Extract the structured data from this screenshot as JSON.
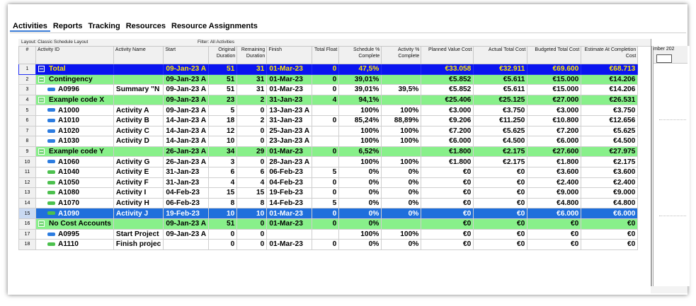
{
  "tabs": [
    "Activities",
    "Reports",
    "Tracking",
    "Resources",
    "Resource Assignments"
  ],
  "layout_label": "Layout: Classic Schedule Layout",
  "filter_label": "Filter: All Activities",
  "gantt_header": "mber 202",
  "columns": [
    {
      "key": "num",
      "label": "#"
    },
    {
      "key": "id",
      "label": "Activity ID"
    },
    {
      "key": "name",
      "label": "Activity Name"
    },
    {
      "key": "start",
      "label": "Start"
    },
    {
      "key": "od",
      "label": "Original Duration"
    },
    {
      "key": "rd",
      "label": "Remaining Duration"
    },
    {
      "key": "finish",
      "label": "Finish"
    },
    {
      "key": "tf",
      "label": "Total Float"
    },
    {
      "key": "spc",
      "label": "Schedule % Complete"
    },
    {
      "key": "apc",
      "label": "Activity % Complete"
    },
    {
      "key": "pvc",
      "label": "Planned Value Cost"
    },
    {
      "key": "atc",
      "label": "Actual Total Cost"
    },
    {
      "key": "btc",
      "label": "Budgeted Total Cost"
    },
    {
      "key": "eac",
      "label": "Estimate At Completion Cost"
    }
  ],
  "rows": [
    {
      "num": "1",
      "type": "total",
      "id": "Total",
      "name": "",
      "start": "09-Jan-23 A",
      "od": "51",
      "rd": "31",
      "finish": "01-Mar-23",
      "tf": "0",
      "spc": "47,5%",
      "apc": "",
      "pvc": "€33.058",
      "atc": "€32.911",
      "btc": "€69.600",
      "eac": "€68.713"
    },
    {
      "num": "2",
      "type": "group",
      "id": "Contingency",
      "name": "",
      "start": "09-Jan-23 A",
      "od": "51",
      "rd": "31",
      "finish": "01-Mar-23",
      "tf": "0",
      "spc": "39,01%",
      "apc": "",
      "pvc": "€5.852",
      "atc": "€5.611",
      "btc": "€15.000",
      "eac": "€14.206"
    },
    {
      "num": "3",
      "type": "act",
      "bar": "blue",
      "id": "A0996",
      "name": "Summary \"N",
      "start": "09-Jan-23 A",
      "od": "51",
      "rd": "31",
      "finish": "01-Mar-23",
      "tf": "0",
      "spc": "39,01%",
      "apc": "39,5%",
      "pvc": "€5.852",
      "atc": "€5.611",
      "btc": "€15.000",
      "eac": "€14.206"
    },
    {
      "num": "4",
      "type": "group",
      "id": "Example code X",
      "name": "",
      "start": "09-Jan-23 A",
      "od": "23",
      "rd": "2",
      "finish": "31-Jan-23",
      "tf": "4",
      "spc": "94,1%",
      "apc": "",
      "pvc": "€25.406",
      "atc": "€25.125",
      "btc": "€27.000",
      "eac": "€26.531"
    },
    {
      "num": "5",
      "type": "act",
      "bar": "blue",
      "id": "A1000",
      "name": "Activity A",
      "start": "09-Jan-23 A",
      "od": "5",
      "rd": "0",
      "finish": "13-Jan-23 A",
      "tf": "",
      "spc": "100%",
      "apc": "100%",
      "pvc": "€3.000",
      "atc": "€3.750",
      "btc": "€3.000",
      "eac": "€3.750"
    },
    {
      "num": "6",
      "type": "act",
      "bar": "blue",
      "id": "A1010",
      "name": "Activity B",
      "start": "14-Jan-23 A",
      "od": "18",
      "rd": "2",
      "finish": "31-Jan-23",
      "tf": "0",
      "spc": "85,24%",
      "apc": "88,89%",
      "pvc": "€9.206",
      "atc": "€11.250",
      "btc": "€10.800",
      "eac": "€12.656"
    },
    {
      "num": "7",
      "type": "act",
      "bar": "blue",
      "id": "A1020",
      "name": "Activity C",
      "start": "14-Jan-23 A",
      "od": "12",
      "rd": "0",
      "finish": "25-Jan-23 A",
      "tf": "",
      "spc": "100%",
      "apc": "100%",
      "pvc": "€7.200",
      "atc": "€5.625",
      "btc": "€7.200",
      "eac": "€5.625"
    },
    {
      "num": "8",
      "type": "act",
      "bar": "blue",
      "id": "A1030",
      "name": "Activity D",
      "start": "14-Jan-23 A",
      "od": "10",
      "rd": "0",
      "finish": "23-Jan-23 A",
      "tf": "",
      "spc": "100%",
      "apc": "100%",
      "pvc": "€6.000",
      "atc": "€4.500",
      "btc": "€6.000",
      "eac": "€4.500"
    },
    {
      "num": "9",
      "type": "group",
      "id": "Example code Y",
      "name": "",
      "start": "26-Jan-23 A",
      "od": "34",
      "rd": "29",
      "finish": "01-Mar-23",
      "tf": "0",
      "spc": "6,52%",
      "apc": "",
      "pvc": "€1.800",
      "atc": "€2.175",
      "btc": "€27.600",
      "eac": "€27.975"
    },
    {
      "num": "10",
      "type": "act",
      "bar": "blue",
      "id": "A1060",
      "name": "Activity G",
      "start": "26-Jan-23 A",
      "od": "3",
      "rd": "0",
      "finish": "28-Jan-23 A",
      "tf": "",
      "spc": "100%",
      "apc": "100%",
      "pvc": "€1.800",
      "atc": "€2.175",
      "btc": "€1.800",
      "eac": "€2.175"
    },
    {
      "num": "11",
      "type": "act",
      "bar": "green",
      "id": "A1040",
      "name": "Activity E",
      "start": "31-Jan-23",
      "od": "6",
      "rd": "6",
      "finish": "06-Feb-23",
      "tf": "5",
      "spc": "0%",
      "apc": "0%",
      "pvc": "€0",
      "atc": "€0",
      "btc": "€3.600",
      "eac": "€3.600"
    },
    {
      "num": "12",
      "type": "act",
      "bar": "green",
      "id": "A1050",
      "name": "Activity F",
      "start": "31-Jan-23",
      "od": "4",
      "rd": "4",
      "finish": "04-Feb-23",
      "tf": "0",
      "spc": "0%",
      "apc": "0%",
      "pvc": "€0",
      "atc": "€0",
      "btc": "€2.400",
      "eac": "€2.400"
    },
    {
      "num": "13",
      "type": "act",
      "bar": "green",
      "id": "A1080",
      "name": "Activity I",
      "start": "04-Feb-23",
      "od": "15",
      "rd": "15",
      "finish": "19-Feb-23",
      "tf": "0",
      "spc": "0%",
      "apc": "0%",
      "pvc": "€0",
      "atc": "€0",
      "btc": "€9.000",
      "eac": "€9.000"
    },
    {
      "num": "14",
      "type": "act",
      "bar": "green",
      "id": "A1070",
      "name": "Activity H",
      "start": "06-Feb-23",
      "od": "8",
      "rd": "8",
      "finish": "14-Feb-23",
      "tf": "5",
      "spc": "0%",
      "apc": "0%",
      "pvc": "€0",
      "atc": "€0",
      "btc": "€4.800",
      "eac": "€4.800"
    },
    {
      "num": "15",
      "type": "sel",
      "bar": "green",
      "id": "A1090",
      "name": "Activity J",
      "start": "19-Feb-23",
      "od": "10",
      "rd": "10",
      "finish": "01-Mar-23",
      "tf": "0",
      "spc": "0%",
      "apc": "0%",
      "pvc": "€0",
      "atc": "€0",
      "btc": "€6.000",
      "eac": "€6.000"
    },
    {
      "num": "16",
      "type": "group",
      "id": "No Cost Accounts",
      "name": "",
      "start": "09-Jan-23 A",
      "od": "51",
      "rd": "0",
      "finish": "01-Mar-23",
      "tf": "0",
      "spc": "0%",
      "apc": "",
      "pvc": "€0",
      "atc": "€0",
      "btc": "€0",
      "eac": "€0"
    },
    {
      "num": "17",
      "type": "act",
      "bar": "blue",
      "id": "A0995",
      "name": "Start Project",
      "start": "09-Jan-23 A",
      "od": "0",
      "rd": "0",
      "finish": "",
      "tf": "",
      "spc": "100%",
      "apc": "100%",
      "pvc": "€0",
      "atc": "€0",
      "btc": "€0",
      "eac": "€0"
    },
    {
      "num": "18",
      "type": "act",
      "bar": "green",
      "id": "A1110",
      "name": "Finish projec",
      "start": "",
      "od": "0",
      "rd": "0",
      "finish": "01-Mar-23",
      "tf": "0",
      "spc": "0%",
      "apc": "0%",
      "pvc": "€0",
      "atc": "€0",
      "btc": "€0",
      "eac": "€0"
    }
  ]
}
